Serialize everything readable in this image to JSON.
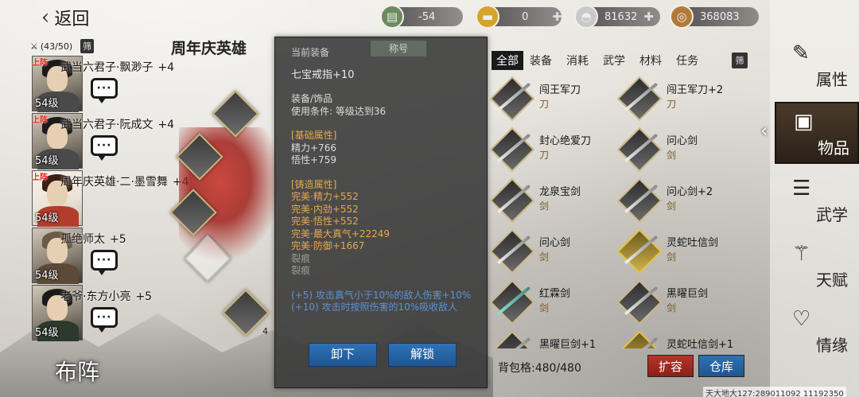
{
  "topbar": {
    "back_label": "返回",
    "currencies": [
      {
        "icon": "cart-icon",
        "value": "-54",
        "has_plus": false,
        "color": "#6b8a5e"
      },
      {
        "icon": "gold-bar-icon",
        "value": "0",
        "has_plus": true,
        "color": "#d4a52a"
      },
      {
        "icon": "silver-ingot-icon",
        "value": "81632",
        "has_plus": true,
        "color": "#c9c9c9"
      },
      {
        "icon": "copper-coin-icon",
        "value": "368083",
        "has_plus": false,
        "color": "#b27a3a"
      }
    ]
  },
  "heroes": {
    "count": "(43/50)",
    "filter_label": "筛",
    "list": [
      {
        "badge": "上阵",
        "name": "武当六君子·飘渺子",
        "plus": "+4",
        "level": "54级",
        "chat": "···"
      },
      {
        "badge": "上阵",
        "name": "武当六君子·阮成文",
        "plus": "+4",
        "level": "54级",
        "chat": "···"
      },
      {
        "badge": "上阵",
        "name": "周年庆英雄·二·墨雪舞",
        "plus": "+4",
        "level": "54级",
        "chat": "···"
      },
      {
        "badge": "",
        "name": "孤绝师太",
        "plus": "+5",
        "level": "54级",
        "chat": "···"
      },
      {
        "badge": "",
        "name": "老爷·东方小亮",
        "plus": "+5",
        "level": "54级",
        "chat": "···"
      }
    ],
    "formation_label": "布阵"
  },
  "hero_display": {
    "title": "周年庆英雄",
    "slot_count": "4"
  },
  "detail": {
    "tag": "称号",
    "section_title": "当前装备",
    "item_name": "七宝戒指+10",
    "category": "装备/饰品",
    "requirement": "使用条件:   等级达到36",
    "base_title": "[基础属性]",
    "base_stats": [
      "精力+766",
      "悟性+759"
    ],
    "forge_title": "[铸造属性]",
    "forge_stats": [
      "完美·精力+552",
      "完美·内劲+552",
      "完美·悟性+552",
      "完美·最大真气+22249",
      "完美·防御+1667"
    ],
    "cracks": [
      "裂痕",
      "裂痕"
    ],
    "effects": [
      "(+5) 攻击真气小于10%的敌人伤害+10%",
      "(+10) 攻击时按照伤害的10%吸收敌人"
    ],
    "unequip_label": "卸下",
    "unlock_label": "解锁"
  },
  "inventory": {
    "tabs": [
      "全部",
      "装备",
      "消耗",
      "武学",
      "材料",
      "任务"
    ],
    "filter_label": "筛",
    "items": [
      {
        "name": "闯王军刀",
        "type": "刀",
        "gold": false
      },
      {
        "name": "闯王军刀+2",
        "type": "刀",
        "gold": false
      },
      {
        "name": "封心绝爱刀",
        "type": "刀",
        "gold": false
      },
      {
        "name": "问心剑",
        "type": "剑",
        "gold": false
      },
      {
        "name": "龙泉宝剑",
        "type": "剑",
        "gold": false
      },
      {
        "name": "问心剑+2",
        "type": "剑",
        "gold": false
      },
      {
        "name": "问心剑",
        "type": "剑",
        "gold": false
      },
      {
        "name": "灵蛇吐信剑",
        "type": "剑",
        "gold": true
      },
      {
        "name": "红霖剑",
        "type": "剑",
        "gold": false
      },
      {
        "name": "黑曜巨剑",
        "type": "剑",
        "gold": false
      },
      {
        "name": "黑曜巨剑+1",
        "type": "",
        "gold": false
      },
      {
        "name": "灵蛇吐信剑+1",
        "type": "",
        "gold": true
      }
    ],
    "bag_count": "背包格:480/480",
    "expand_label": "扩容",
    "warehouse_label": "仓库"
  },
  "nav": [
    {
      "label": "属性",
      "icon": "bird-icon"
    },
    {
      "label": "物品",
      "icon": "box-icon"
    },
    {
      "label": "武学",
      "icon": "book-icon"
    },
    {
      "label": "天赋",
      "icon": "talent-icon"
    },
    {
      "label": "情缘",
      "icon": "heart-icon"
    }
  ],
  "footer": "天大地大127:289011092 11192350"
}
